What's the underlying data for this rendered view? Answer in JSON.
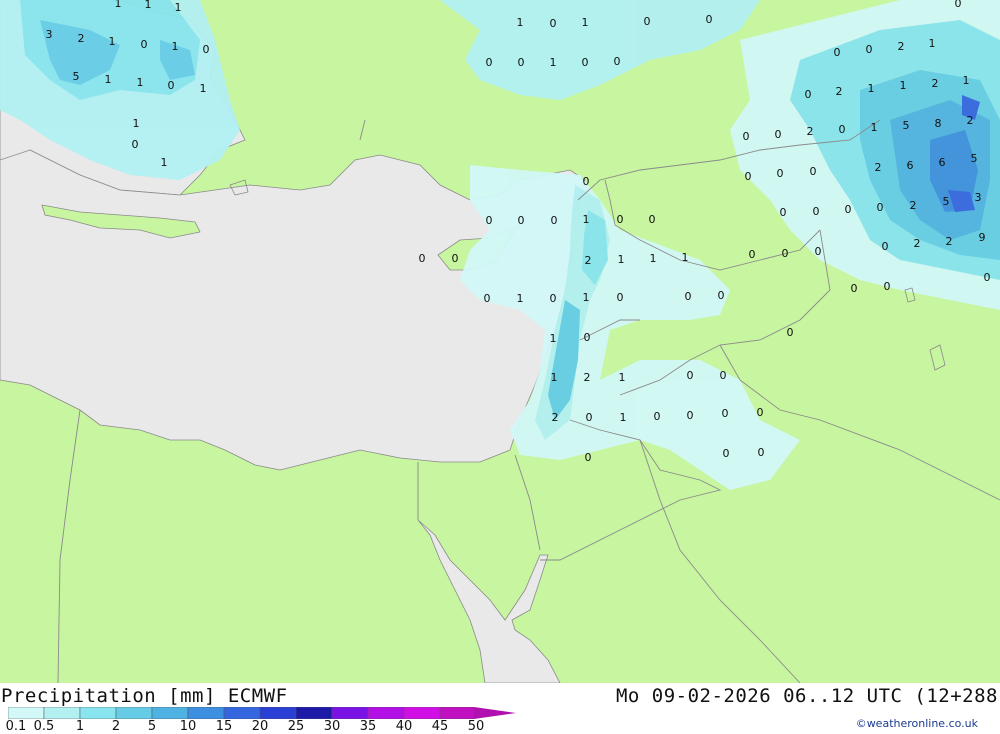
{
  "title": "Precipitation [mm] ECMWF",
  "datetime": "Mo 09-02-2026 06..12 UTC (12+288",
  "credit": "©weatheronline.co.uk",
  "colors": {
    "land": "#c7f5a0",
    "sea": "#e9e9e9",
    "border": "#8a8a8a"
  },
  "scale": {
    "labels": [
      "0.1",
      "0.5",
      "1",
      "2",
      "5",
      "10",
      "15",
      "20",
      "25",
      "30",
      "35",
      "40",
      "45",
      "50"
    ],
    "colors": [
      "#d2f8f8",
      "#b2f0f2",
      "#88e4ee",
      "#66cce6",
      "#4fb2e2",
      "#3d8fe0",
      "#3466e0",
      "#2a3fd4",
      "#1c1aa6",
      "#7a12e6",
      "#b20ee6",
      "#d20ee6",
      "#c010c0"
    ]
  },
  "map_values": [
    {
      "id": "aegean-1",
      "text": "1"
    },
    {
      "id": "aegean-2",
      "text": "1"
    },
    {
      "id": "aegean-3",
      "text": "1"
    },
    {
      "id": "aegean-4",
      "text": "3"
    },
    {
      "id": "aegean-5",
      "text": "2"
    },
    {
      "id": "aegean-6",
      "text": "1"
    },
    {
      "id": "aegean-7",
      "text": "0"
    },
    {
      "id": "aegean-8",
      "text": "1"
    },
    {
      "id": "aegean-9",
      "text": "0"
    },
    {
      "id": "aegean-10",
      "text": "5"
    },
    {
      "id": "aegean-11",
      "text": "1"
    },
    {
      "id": "aegean-12",
      "text": "1"
    },
    {
      "id": "aegean-13",
      "text": "0"
    },
    {
      "id": "aegean-14",
      "text": "1"
    },
    {
      "id": "aegean-15",
      "text": "1"
    },
    {
      "id": "aegean-16",
      "text": "0"
    },
    {
      "id": "aegean-17",
      "text": "1"
    },
    {
      "id": "turkey-1",
      "text": "1"
    },
    {
      "id": "turkey-2",
      "text": "0"
    },
    {
      "id": "turkey-3",
      "text": "1"
    },
    {
      "id": "turkey-4",
      "text": "0"
    },
    {
      "id": "turkey-5",
      "text": "0"
    },
    {
      "id": "turkey-6",
      "text": "0"
    },
    {
      "id": "turkey-7",
      "text": "0"
    },
    {
      "id": "turkey-8",
      "text": "1"
    },
    {
      "id": "turkey-9",
      "text": "0"
    },
    {
      "id": "turkey-10",
      "text": "0"
    },
    {
      "id": "ne-1",
      "text": "0"
    },
    {
      "id": "ne-2",
      "text": "0"
    },
    {
      "id": "ne-3",
      "text": "2"
    },
    {
      "id": "ne-4",
      "text": "1"
    },
    {
      "id": "ne-5",
      "text": "0"
    },
    {
      "id": "ne-6",
      "text": "0"
    },
    {
      "id": "ne-7",
      "text": "2"
    },
    {
      "id": "ne-8",
      "text": "1"
    },
    {
      "id": "ne-9",
      "text": "1"
    },
    {
      "id": "ne-10",
      "text": "2"
    },
    {
      "id": "ne-11",
      "text": "1"
    },
    {
      "id": "ne-12",
      "text": "0"
    },
    {
      "id": "ne-13",
      "text": "0"
    },
    {
      "id": "ne-14",
      "text": "2"
    },
    {
      "id": "ne-15",
      "text": "0"
    },
    {
      "id": "ne-16",
      "text": "1"
    },
    {
      "id": "ne-17",
      "text": "5"
    },
    {
      "id": "ne-18",
      "text": "8"
    },
    {
      "id": "ne-19",
      "text": "2"
    },
    {
      "id": "ne-20",
      "text": "0"
    },
    {
      "id": "ne-21",
      "text": "0"
    },
    {
      "id": "ne-22",
      "text": "0"
    },
    {
      "id": "ne-23",
      "text": "2"
    },
    {
      "id": "ne-24",
      "text": "6"
    },
    {
      "id": "ne-25",
      "text": "6"
    },
    {
      "id": "ne-26",
      "text": "5"
    },
    {
      "id": "ne-27",
      "text": "0"
    },
    {
      "id": "ne-28",
      "text": "0"
    },
    {
      "id": "ne-29",
      "text": "0"
    },
    {
      "id": "ne-30",
      "text": "0"
    },
    {
      "id": "ne-31",
      "text": "2"
    },
    {
      "id": "ne-32",
      "text": "5"
    },
    {
      "id": "ne-33",
      "text": "3"
    },
    {
      "id": "ne-34",
      "text": "0"
    },
    {
      "id": "ne-35",
      "text": "2"
    },
    {
      "id": "ne-36",
      "text": "2"
    },
    {
      "id": "ne-37",
      "text": "9"
    },
    {
      "id": "ne-38",
      "text": "0"
    },
    {
      "id": "ne-39",
      "text": "0"
    },
    {
      "id": "ne-40",
      "text": "0"
    },
    {
      "id": "ne-41",
      "text": "0"
    },
    {
      "id": "ne-42",
      "text": "0"
    },
    {
      "id": "ne-43",
      "text": "0"
    },
    {
      "id": "lev-1",
      "text": "0"
    },
    {
      "id": "lev-2",
      "text": "0"
    },
    {
      "id": "lev-3",
      "text": "0"
    },
    {
      "id": "lev-4",
      "text": "0"
    },
    {
      "id": "lev-5",
      "text": "1"
    },
    {
      "id": "lev-6",
      "text": "0"
    },
    {
      "id": "lev-7",
      "text": "0"
    },
    {
      "id": "lev-8",
      "text": "0"
    },
    {
      "id": "lev-9",
      "text": "0"
    },
    {
      "id": "lev-10",
      "text": "2"
    },
    {
      "id": "lev-11",
      "text": "1"
    },
    {
      "id": "lev-12",
      "text": "1"
    },
    {
      "id": "lev-13",
      "text": "1"
    },
    {
      "id": "lev-14",
      "text": "0"
    },
    {
      "id": "lev-15",
      "text": "1"
    },
    {
      "id": "lev-16",
      "text": "0"
    },
    {
      "id": "lev-17",
      "text": "1"
    },
    {
      "id": "lev-18",
      "text": "0"
    },
    {
      "id": "lev-19",
      "text": "0"
    },
    {
      "id": "lev-20",
      "text": "0"
    },
    {
      "id": "lev-21",
      "text": "1"
    },
    {
      "id": "lev-22",
      "text": "0"
    },
    {
      "id": "lev-23",
      "text": "0"
    },
    {
      "id": "lev-24",
      "text": "1"
    },
    {
      "id": "lev-25",
      "text": "2"
    },
    {
      "id": "lev-26",
      "text": "1"
    },
    {
      "id": "lev-27",
      "text": "0"
    },
    {
      "id": "lev-28",
      "text": "0"
    },
    {
      "id": "lev-29",
      "text": "2"
    },
    {
      "id": "lev-30",
      "text": "0"
    },
    {
      "id": "lev-31",
      "text": "1"
    },
    {
      "id": "lev-32",
      "text": "0"
    },
    {
      "id": "lev-33",
      "text": "0"
    },
    {
      "id": "lev-34",
      "text": "0"
    },
    {
      "id": "lev-35",
      "text": "0"
    },
    {
      "id": "lev-36",
      "text": "0"
    },
    {
      "id": "lev-37",
      "text": "0"
    },
    {
      "id": "lev-38",
      "text": "0"
    },
    {
      "id": "lev-39",
      "text": "0"
    }
  ]
}
